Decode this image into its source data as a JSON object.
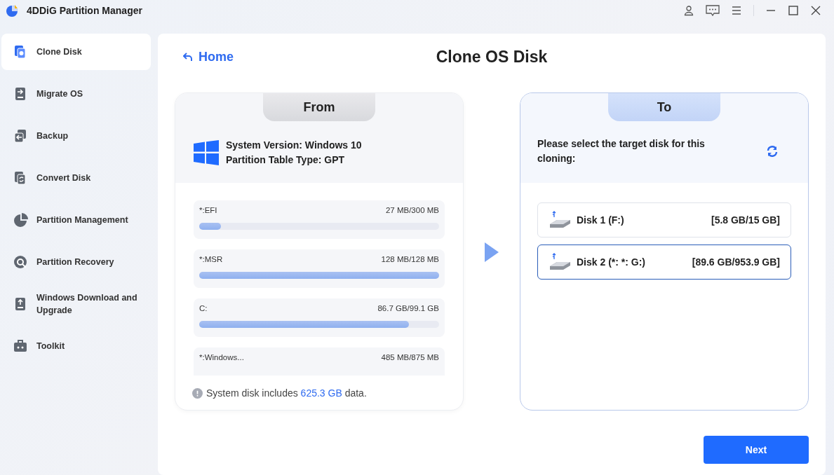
{
  "window": {
    "title": "4DDiG Partition Manager"
  },
  "sidebar": {
    "items": [
      {
        "label": "Clone Disk",
        "selected": true
      },
      {
        "label": "Migrate OS",
        "selected": false
      },
      {
        "label": "Backup",
        "selected": false
      },
      {
        "label": "Convert Disk",
        "selected": false
      },
      {
        "label": "Partition Management",
        "selected": false
      },
      {
        "label": "Partition Recovery",
        "selected": false
      },
      {
        "label": "Windows Download and Upgrade",
        "selected": false
      },
      {
        "label": "Toolkit",
        "selected": false
      }
    ]
  },
  "header": {
    "back_link": "Home",
    "title": "Clone OS Disk"
  },
  "from": {
    "tab": "From",
    "system_version": "System Version: Windows 10",
    "partition_table": "Partition Table Type: GPT",
    "partitions": [
      {
        "name": "*:EFI",
        "usage": "27 MB/300 MB",
        "level": 0.09
      },
      {
        "name": "*:MSR",
        "usage": "128 MB/128 MB",
        "level": 1
      },
      {
        "name": "C:",
        "usage": "86.7 GB/99.1 GB",
        "level": 0.875
      },
      {
        "name": "*:Windows...",
        "usage": "485 MB/875 MB"
      }
    ],
    "note": {
      "before": "System disk includes ",
      "amount": "625.3 GB",
      "after": " data."
    }
  },
  "to": {
    "tab": "To",
    "prompt": "Please select the target disk for this cloning:",
    "disks": [
      {
        "name": "Disk 1 (F:)",
        "size": "[5.8 GB/15 GB]",
        "selected": false
      },
      {
        "name": "Disk 2 (*: *: G:)",
        "size": "[89.6 GB/953.9 GB]",
        "selected": true
      }
    ]
  },
  "next_button": "Next"
}
